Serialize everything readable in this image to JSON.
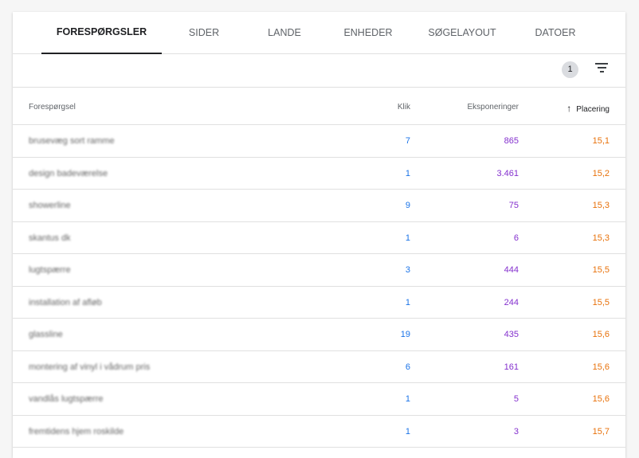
{
  "tabs": [
    "FORESPØRGSLER",
    "SIDER",
    "LANDE",
    "ENHEDER",
    "SØGELAYOUT",
    "DATOER"
  ],
  "filter_count": "1",
  "columns": {
    "query": "Forespørgsel",
    "clicks": "Klik",
    "impressions": "Eksponeringer",
    "position": "Placering"
  },
  "sort_icon": "↑",
  "rows": [
    {
      "q": "brusevæg sort ramme",
      "c": "7",
      "i": "865",
      "p": "15,1"
    },
    {
      "q": "design badeværelse",
      "c": "1",
      "i": "3.461",
      "p": "15,2"
    },
    {
      "q": "showerline",
      "c": "9",
      "i": "75",
      "p": "15,3"
    },
    {
      "q": "skantus dk",
      "c": "1",
      "i": "6",
      "p": "15,3"
    },
    {
      "q": "lugtspærre",
      "c": "3",
      "i": "444",
      "p": "15,5"
    },
    {
      "q": "installation af afløb",
      "c": "1",
      "i": "244",
      "p": "15,5"
    },
    {
      "q": "glassline",
      "c": "19",
      "i": "435",
      "p": "15,6"
    },
    {
      "q": "montering af vinyl i vådrum pris",
      "c": "6",
      "i": "161",
      "p": "15,6"
    },
    {
      "q": "vandlås lugtspærre",
      "c": "1",
      "i": "5",
      "p": "15,6"
    },
    {
      "q": "fremtidens hjem roskilde",
      "c": "1",
      "i": "3",
      "p": "15,7"
    }
  ]
}
